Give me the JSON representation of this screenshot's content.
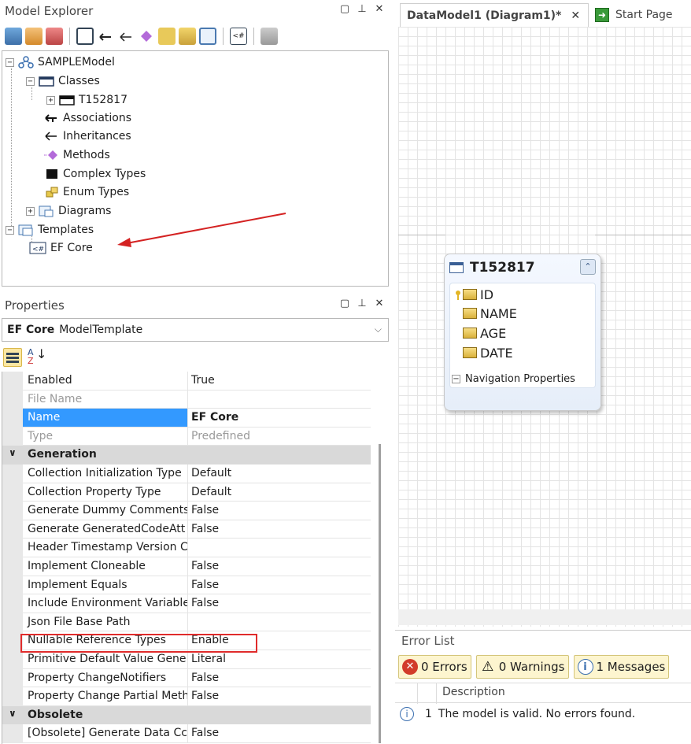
{
  "model_explorer": {
    "title": "Model Explorer",
    "tree": {
      "root": "SAMPLEModel",
      "classes": "Classes",
      "class_item": "T152817",
      "associations": "Associations",
      "inheritances": "Inheritances",
      "methods": "Methods",
      "complex_types": "Complex Types",
      "enum_types": "Enum Types",
      "diagrams": "Diagrams",
      "templates": "Templates",
      "template_item": "EF Core"
    }
  },
  "properties": {
    "title": "Properties",
    "selected_object": "EF Core",
    "selected_type": "ModelTemplate",
    "rows": [
      {
        "name": "Enabled",
        "value": "True"
      },
      {
        "name": "File Name",
        "value": ""
      },
      {
        "name": "Name",
        "value": "EF Core"
      },
      {
        "name": "Type",
        "value": "Predefined"
      }
    ],
    "category_generation": "Generation",
    "generation_rows": [
      {
        "name": "Collection Initialization Type",
        "value": "Default"
      },
      {
        "name": "Collection Property Type",
        "value": "Default"
      },
      {
        "name": "Generate Dummy Comments",
        "value": "False"
      },
      {
        "name": "Generate GeneratedCodeAtt",
        "value": "False"
      },
      {
        "name": "Header Timestamp Version C",
        "value": ""
      },
      {
        "name": "Implement Cloneable",
        "value": "False"
      },
      {
        "name": "Implement Equals",
        "value": "False"
      },
      {
        "name": "Include Environment Variable",
        "value": "False"
      },
      {
        "name": "Json File Base Path",
        "value": ""
      },
      {
        "name": "Nullable Reference Types",
        "value": "Enable"
      },
      {
        "name": "Primitive Default Value Gene",
        "value": "Literal"
      },
      {
        "name": "Property ChangeNotifiers",
        "value": "False"
      },
      {
        "name": "Property Change Partial Meth",
        "value": "False"
      }
    ],
    "category_obsolete": "Obsolete",
    "obsolete_rows": [
      {
        "name": "[Obsolete] Generate Data Cc",
        "value": "False"
      }
    ]
  },
  "document": {
    "active_tab": "DataModel1 (Diagram1)*",
    "close_glyph": "✕",
    "start_tab": "Start Page"
  },
  "entity": {
    "name": "T152817",
    "fields": [
      "ID",
      "NAME",
      "AGE",
      "DATE"
    ],
    "nav_label": "Navigation Properties"
  },
  "error_list": {
    "title": "Error List",
    "errors_label": "0 Errors",
    "warnings_label": "0 Warnings",
    "messages_label": "1 Messages",
    "column_description": "Description",
    "row_index": "1",
    "row_text": "The model is valid. No errors found."
  },
  "colors": {
    "selection": "#3399ff",
    "highlight_box": "#e02b2b",
    "annotation_arrow": "#d42222",
    "category_bg": "#d9d9d9"
  }
}
